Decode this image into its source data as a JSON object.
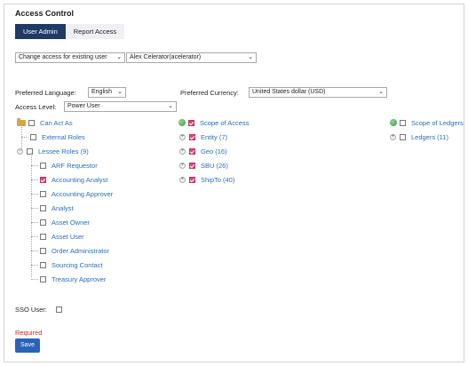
{
  "page": {
    "title": "Access Control"
  },
  "tabs": [
    {
      "label": "User Admin",
      "active": true
    },
    {
      "label": "Report Access",
      "active": false
    }
  ],
  "mode_select": {
    "value": "Change access for existing user"
  },
  "user_select": {
    "value": "Alex Celerator(acelerator)"
  },
  "preferred_language": {
    "label": "Preferred Language:",
    "value": "English"
  },
  "preferred_currency": {
    "label": "Preferred Currency:",
    "value": "United States dollar (USD)"
  },
  "access_level": {
    "label": "Access Level:",
    "value": "Power User"
  },
  "roles_tree": {
    "root": {
      "label": "Can Act As",
      "checked": false
    },
    "external": {
      "label": "External Roles",
      "checked": false
    },
    "lessee": {
      "label": "Lessee Roles (9)",
      "checked": false
    },
    "children": [
      {
        "label": "ARF Requestor",
        "checked": false
      },
      {
        "label": "Accounting Analyst",
        "checked": true
      },
      {
        "label": "Accounting Approver",
        "checked": false
      },
      {
        "label": "Analyst",
        "checked": false
      },
      {
        "label": "Asset Owner",
        "checked": false
      },
      {
        "label": "Asset User",
        "checked": false
      },
      {
        "label": "Order Administrator",
        "checked": false
      },
      {
        "label": "Sourcing Contact",
        "checked": false
      },
      {
        "label": "Treasury Approver",
        "checked": false
      }
    ]
  },
  "scope_tree": {
    "root": {
      "label": "Scope of Access",
      "checked": true
    },
    "children": [
      {
        "label": "Entity (7)",
        "checked": true
      },
      {
        "label": "Geo (16)",
        "checked": true
      },
      {
        "label": "SBU (26)",
        "checked": true
      },
      {
        "label": "ShipTo (40)",
        "checked": true
      }
    ]
  },
  "ledgers_tree": {
    "root": {
      "label": "Scope of Ledgers",
      "checked": false
    },
    "children": [
      {
        "label": "Ledgers (11)",
        "checked": false
      }
    ]
  },
  "sso": {
    "label": "SSO User:",
    "checked": false
  },
  "required_text": "Required",
  "save_label": "Save"
}
